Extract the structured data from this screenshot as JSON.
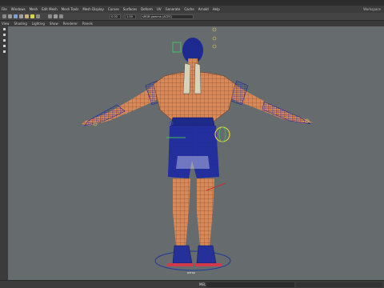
{
  "window": {
    "title": ""
  },
  "menu": {
    "items": [
      "File",
      "Windows",
      "Mesh",
      "Edit Mesh",
      "Mesh Tools",
      "Mesh Display",
      "Curves",
      "Surfaces",
      "Deform",
      "UV",
      "Generate",
      "Cache",
      "Arnold",
      "Help"
    ],
    "workspace": "Workspace"
  },
  "toolbar": {
    "field1": "0.00",
    "field2": "1.00",
    "color_space": "sRGB gamma (ACES)",
    "icons": [
      "grid-icon",
      "camera-icon",
      "wireframe-icon",
      "shaded-icon",
      "texture-icon",
      "light-icon",
      "shadow-icon",
      "isolate-icon",
      "xray-icon",
      "resolution-gate-icon"
    ]
  },
  "panel_menu": {
    "items": [
      "View",
      "Shading",
      "Lighting",
      "Show",
      "Renderer",
      "Panels"
    ]
  },
  "viewport": {
    "camera": "persp",
    "background": "#666b6e",
    "wire_color": "#1e2a9a",
    "skin_color": "#d8895a"
  },
  "status": {
    "mel_label": "MEL"
  }
}
